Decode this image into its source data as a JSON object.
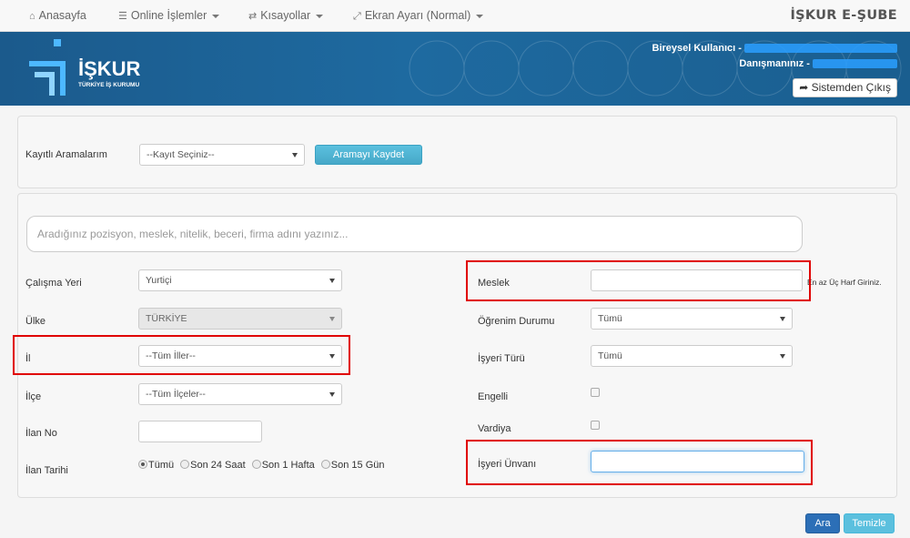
{
  "nav": {
    "home": "Anasayfa",
    "online": "Online İşlemler",
    "shortcuts": "Kısayollar",
    "screen": "Ekran Ayarı (Normal)",
    "brand": "İŞKUR E-ŞUBE"
  },
  "header": {
    "logo_text": "İŞKUR",
    "logo_sub": "TÜRKİYE İŞ KURUMU",
    "user_label": "Bireysel Kullanıcı -",
    "advisor_label": "Danışmanınız -",
    "logout": "Sistemden Çıkış"
  },
  "saved": {
    "label": "Kayıtlı Aramalarım",
    "select_value": "--Kayıt Seçiniz--",
    "save_button": "Aramayı Kaydet"
  },
  "search": {
    "placeholder": "Aradığınız pozisyon, meslek, nitelik, beceri, firma adını yazınız..."
  },
  "left": {
    "workplace_label": "Çalışma Yeri",
    "workplace_value": "Yurtiçi",
    "country_label": "Ülke",
    "country_value": "TÜRKİYE",
    "province_label": "İl",
    "province_value": "--Tüm İller--",
    "district_label": "İlçe",
    "district_value": "--Tüm İlçeler--",
    "ad_no_label": "İlan No",
    "ad_date_label": "İlan Tarihi",
    "date_options": [
      "Tümü",
      "Son 24 Saat",
      "Son 1 Hafta",
      "Son 15 Gün"
    ]
  },
  "right": {
    "profession_label": "Meslek",
    "profession_hint": "En az Üç Harf Giriniz.",
    "education_label": "Öğrenim Durumu",
    "education_value": "Tümü",
    "employer_type_label": "İşyeri Türü",
    "employer_type_value": "Tümü",
    "disabled_label": "Engelli",
    "shift_label": "Vardiya",
    "employer_title_label": "İşyeri Ünvanı"
  },
  "actions": {
    "search": "Ara",
    "clear": "Temizle"
  },
  "colors": {
    "banner": "#1e6aa0",
    "highlight": "#e00000",
    "primary": "#2c6fb7",
    "info": "#5bc0de"
  }
}
